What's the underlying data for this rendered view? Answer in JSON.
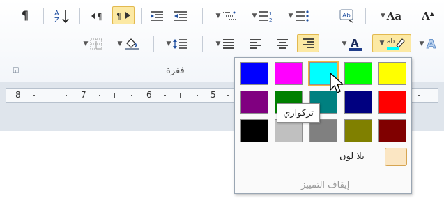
{
  "ribbon": {
    "group_label": "فقرة",
    "font_size_label": "Aa"
  },
  "ruler": {
    "numbers": [
      "8",
      "7",
      "6",
      "5"
    ]
  },
  "highlight_dropdown": {
    "colors": [
      [
        "#0000ff",
        "#ff00ff",
        "#00ffff",
        "#00ff00",
        "#ffff00"
      ],
      [
        "#800080",
        "#008000",
        "#008080",
        "#000080",
        "#ff0000"
      ],
      [
        "#000000",
        "#c0c0c0",
        "#808080",
        "#808000",
        "#800000"
      ]
    ],
    "selected_color": "#00ffff",
    "tooltip": "تركوازي",
    "no_color_label": "بلا لون",
    "stop_highlighting_label": "إيقاف التمييز"
  }
}
